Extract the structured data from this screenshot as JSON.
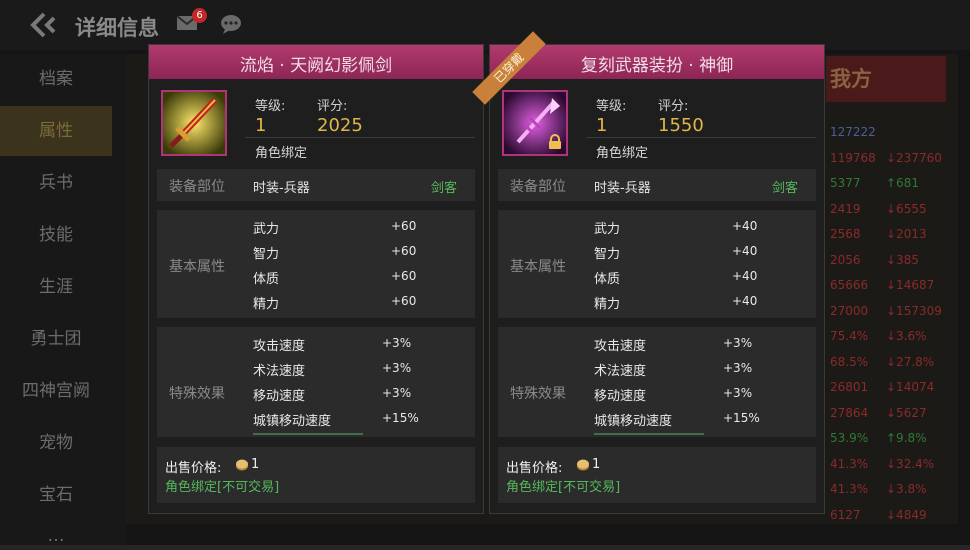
{
  "header": {
    "title": "详细信息",
    "mail_badge": "6"
  },
  "sidebar": {
    "items": [
      {
        "label": "档案"
      },
      {
        "label": "属性"
      },
      {
        "label": "兵书"
      },
      {
        "label": "技能"
      },
      {
        "label": "生涯"
      },
      {
        "label": "勇士团"
      },
      {
        "label": "四神宫阙"
      },
      {
        "label": "宠物"
      },
      {
        "label": "宝石"
      },
      {
        "label": "…"
      }
    ]
  },
  "background": {
    "our_side": "我方",
    "col1": [
      "127222",
      "119768",
      "5377",
      "2419",
      "2568",
      "2056",
      "65666",
      "27000",
      "75.4%",
      "68.5%",
      "26801",
      "27864",
      "53.9%",
      "41.3%",
      "41.3%",
      "6127"
    ],
    "col2": [
      "",
      "237760",
      "681",
      "6555",
      "2013",
      "385",
      "14687",
      "157309",
      "3.6%",
      "27.8%",
      "14074",
      "5627",
      "9.8%",
      "32.4%",
      "3.8%",
      "4849"
    ]
  },
  "cards": [
    {
      "name": "流焰 · 天阙幻影佩剑",
      "level_label": "等级:",
      "level": "1",
      "score_label": "评分:",
      "score": "2025",
      "bind": "角色绑定",
      "slot_label": "装备部位",
      "slot_value": "时装-兵器",
      "slot_class": "剑客",
      "base_label": "基本属性",
      "base_attrs": [
        {
          "name": "武力",
          "value": "+60"
        },
        {
          "name": "智力",
          "value": "+60"
        },
        {
          "name": "体质",
          "value": "+60"
        },
        {
          "name": "精力",
          "value": "+60"
        }
      ],
      "special_label": "特殊效果",
      "special_attrs": [
        {
          "name": "攻击速度",
          "value": "+3%"
        },
        {
          "name": "术法速度",
          "value": "+3%"
        },
        {
          "name": "移动速度",
          "value": "+3%"
        },
        {
          "name": "城镇移动速度",
          "value": "+15%"
        }
      ],
      "price_label": "出售价格:",
      "price_value": "1",
      "trade_note": "角色绑定[不可交易]"
    },
    {
      "name": "复刻武器装扮 · 神御",
      "ribbon": "已穿戴",
      "level_label": "等级:",
      "level": "1",
      "score_label": "评分:",
      "score": "1550",
      "bind": "角色绑定",
      "slot_label": "装备部位",
      "slot_value": "时装-兵器",
      "slot_class": "剑客",
      "base_label": "基本属性",
      "base_attrs": [
        {
          "name": "武力",
          "value": "+40"
        },
        {
          "name": "智力",
          "value": "+40"
        },
        {
          "name": "体质",
          "value": "+40"
        },
        {
          "name": "精力",
          "value": "+40"
        }
      ],
      "special_label": "特殊效果",
      "special_attrs": [
        {
          "name": "攻击速度",
          "value": "+3%"
        },
        {
          "name": "术法速度",
          "value": "+3%"
        },
        {
          "name": "移动速度",
          "value": "+3%"
        },
        {
          "name": "城镇移动速度",
          "value": "+15%"
        }
      ],
      "price_label": "出售价格:",
      "price_value": "1",
      "trade_note": "角色绑定[不可交易]"
    }
  ],
  "colors": {
    "header_magenta": "#9e2f62",
    "gold": "#e0b64a",
    "green": "#56b85c",
    "ribbon": "#c8803a"
  }
}
